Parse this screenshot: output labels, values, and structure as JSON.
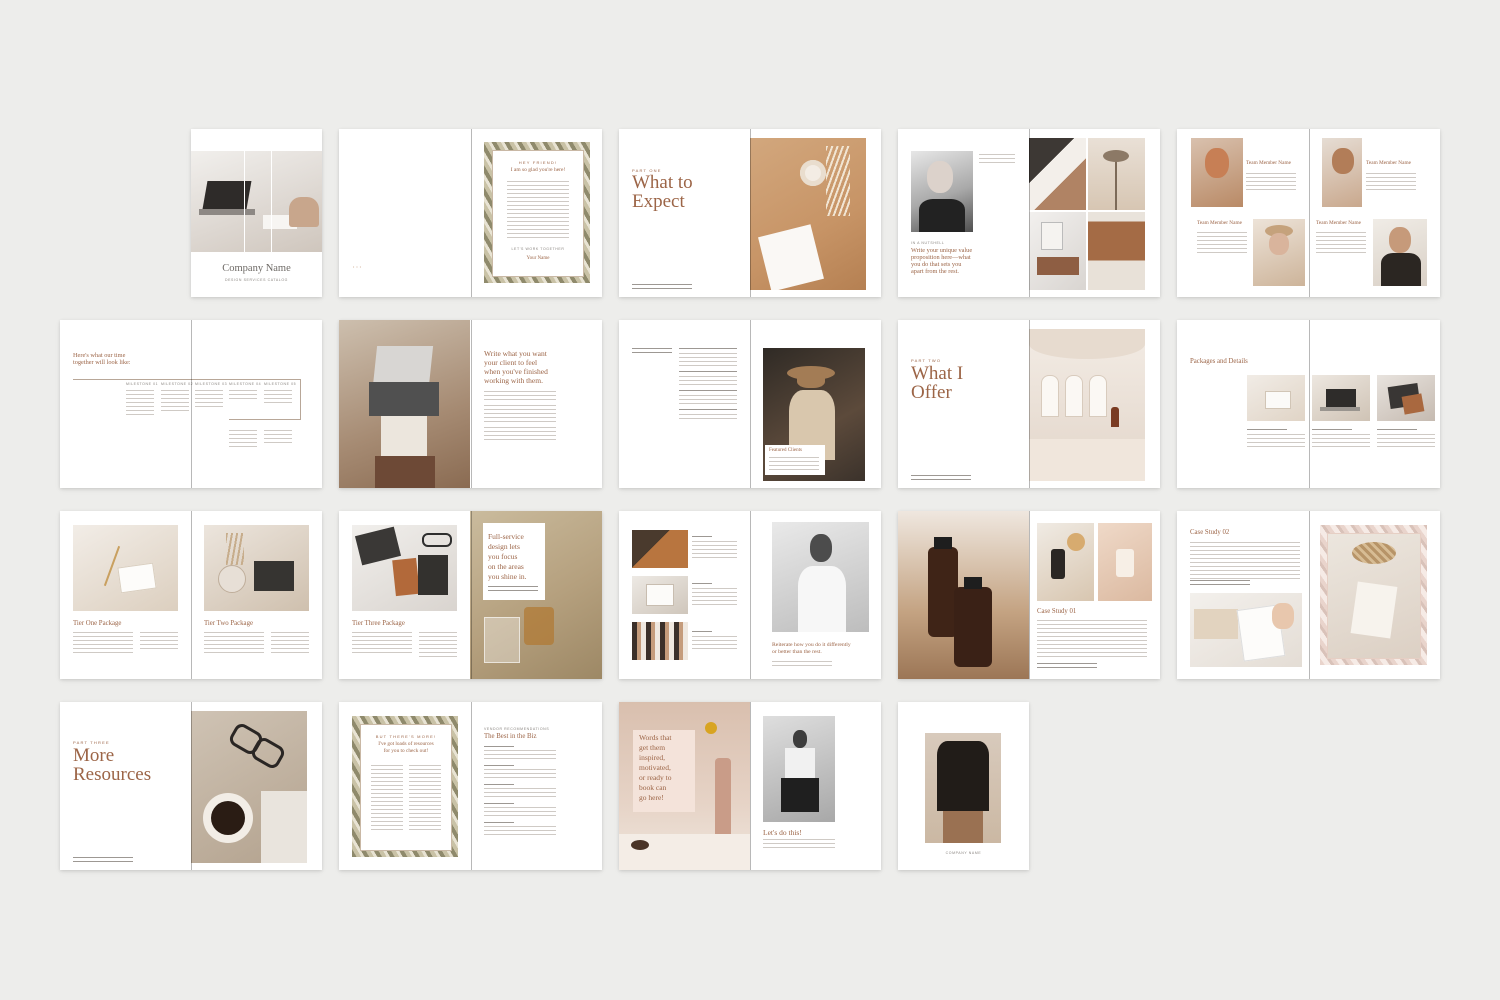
{
  "cover": {
    "company_name": "Company Name",
    "subtitle": "Design Services Catalog"
  },
  "welcome": {
    "kicker": "Hey Friend!",
    "heading": "I am so glad you're here!",
    "signoff": "Let's work together",
    "name": "Your Name"
  },
  "part_one": {
    "kicker": "Part One",
    "title_line1": "What to",
    "title_line2": "Expect"
  },
  "value": {
    "heading_line1": "Write your unique value",
    "heading_line2": "proposition here—what",
    "heading_line3": "you do that sets you",
    "heading_line4": "apart from the rest."
  },
  "team": {
    "member": "Team Member Name"
  },
  "timeline": {
    "heading_line1": "Here's what our time",
    "heading_line2": "together will look like:",
    "milestones": [
      "Milestone 01",
      "Milestone 02",
      "Milestone 03",
      "Milestone 04",
      "Milestone 05"
    ]
  },
  "client_feel": {
    "line1": "Write what you want",
    "line2": "your client to feel",
    "line3": "when you've finished",
    "line4": "working with them."
  },
  "featured": {
    "caption": "Featured Clients"
  },
  "part_two": {
    "kicker": "Part Two",
    "title_line1": "What I",
    "title_line2": "Offer"
  },
  "packages": {
    "heading": "Packages and Details"
  },
  "tiers": {
    "one": "Tier One Package",
    "two": "Tier Two Package",
    "three": "Tier Three Package"
  },
  "full_service": {
    "line1": "Full-service",
    "line2": "design lets",
    "line3": "you focus",
    "line4": "on the areas",
    "line5": "you shine in."
  },
  "reiterate": {
    "line1": "Reiterate how you do it differently",
    "line2": "or better than the rest."
  },
  "case_study": {
    "one": "Case Study 01",
    "two": "Case Study 02"
  },
  "part_three": {
    "kicker": "Part Three",
    "title_line1": "More",
    "title_line2": "Resources"
  },
  "resources": {
    "kicker": "But there's more!",
    "line1": "I've got loads of resources",
    "line2": "for you to check out!"
  },
  "best_biz": {
    "kicker": "Vendor Recommendations",
    "heading": "The Best in the Biz"
  },
  "words": {
    "line1": "Words that",
    "line2": "get them",
    "line3": "inspired,",
    "line4": "motivated,",
    "line5": "or ready to",
    "line6": "book can",
    "line7": "go here!",
    "cta": "Let's do this!"
  },
  "back": {
    "caption": "Company Name"
  },
  "colors": {
    "accent": "#9c6547",
    "background": "#ededeb",
    "page": "#ffffff"
  }
}
